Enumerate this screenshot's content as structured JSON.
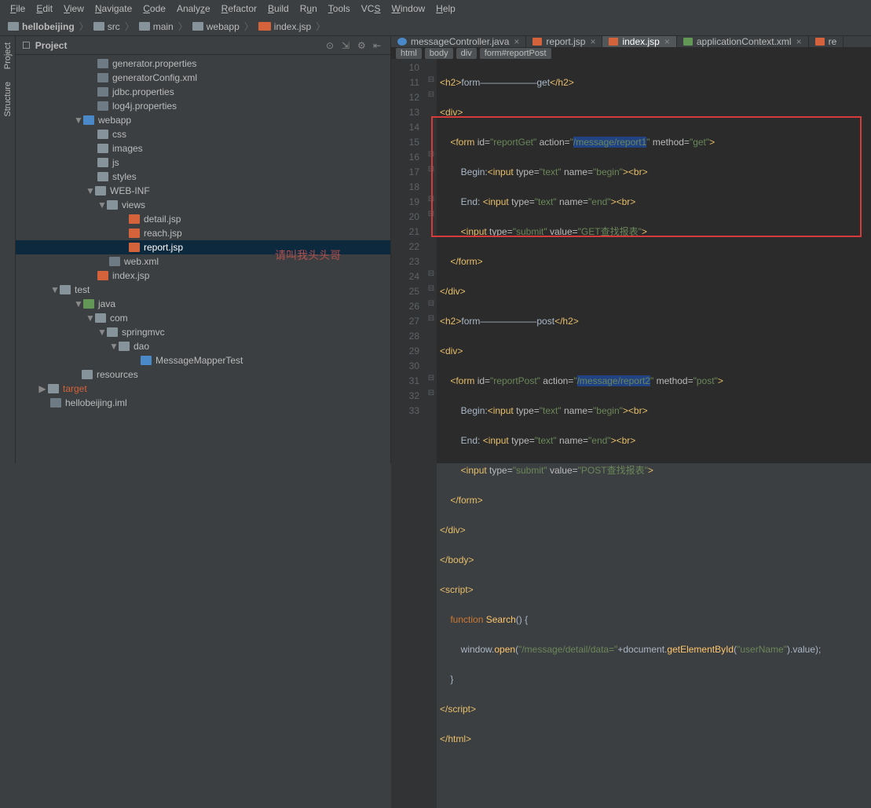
{
  "menu": {
    "items": [
      "File",
      "Edit",
      "View",
      "Navigate",
      "Code",
      "Analyze",
      "Refactor",
      "Build",
      "Run",
      "Tools",
      "VCS",
      "Window",
      "Help"
    ]
  },
  "breadcrumb": {
    "project": "hellobeijing",
    "a": "src",
    "b": "main",
    "c": "webapp",
    "file": "index.jsp"
  },
  "rail": {
    "project": "Project",
    "structure": "Structure"
  },
  "projectPanel": {
    "title": "Project"
  },
  "tree": {
    "n0": "generator.properties",
    "n1": "generatorConfig.xml",
    "n2": "jdbc.properties",
    "n3": "log4j.properties",
    "n4": "webapp",
    "n5": "css",
    "n6": "images",
    "n7": "js",
    "n8": "styles",
    "n9": "WEB-INF",
    "n10": "views",
    "n11": "detail.jsp",
    "n12": "reach.jsp",
    "n13": "report.jsp",
    "n14": "web.xml",
    "n15": "index.jsp",
    "n16": "test",
    "n17": "java",
    "n18": "com",
    "n19": "springmvc",
    "n20": "dao",
    "n21": "MessageMapperTest",
    "n22": "resources",
    "n23": "target",
    "n24": "hellobeijing.iml"
  },
  "watermark": "请叫我头头哥",
  "tabs": {
    "t0": "messageController.java",
    "t1": "report.jsp",
    "t2": "index.jsp",
    "t3": "applicationContext.xml",
    "t4": "re"
  },
  "bc2": {
    "a": "html",
    "b": "body",
    "c": "div",
    "d": "form#reportPost"
  },
  "lines": {
    "l10": "10",
    "l11": "11",
    "l12": "12",
    "l13": "13",
    "l14": "14",
    "l15": "15",
    "l16": "16",
    "l17": "17",
    "l18": "18",
    "l19": "19",
    "l20": "20",
    "l21": "21",
    "l22": "22",
    "l23": "23",
    "l24": "24",
    "l25": "25",
    "l26": "26",
    "l27": "27",
    "l28": "28",
    "l29": "29",
    "l30": "30",
    "l31": "31",
    "l32": "32",
    "l33": "33"
  },
  "code": {
    "c10_a": "<h2>",
    "c10_b": "form——————get",
    "c10_c": "</h2>",
    "c11_a": "<div>",
    "c12_a": "    <form ",
    "c12_b": "id=",
    "c12_c": "\"reportGet\"",
    "c12_d": " action=",
    "c12_e": "\"",
    "c12_f": "/message/report1",
    "c12_g": "\"",
    "c12_h": " method=",
    "c12_i": "\"get\"",
    "c12_j": ">",
    "c13_a": "        Begin:",
    "c13_b": "<input ",
    "c13_c": "type=",
    "c13_d": "\"text\"",
    "c13_e": " name=",
    "c13_f": "\"begin\"",
    "c13_g": "><br>",
    "c14_a": "        End: ",
    "c14_b": "<input ",
    "c14_c": "type=",
    "c14_d": "\"text\"",
    "c14_e": " name=",
    "c14_f": "\"end\"",
    "c14_g": "><br>",
    "c15_a": "        ",
    "c15_b": "<input ",
    "c15_c": "type=",
    "c15_d": "\"submit\"",
    "c15_e": " value=",
    "c15_f": "\"GET查找报表\"",
    "c15_g": ">",
    "c16_a": "    </form>",
    "c17_a": "</div>",
    "c18_a": "<h2>",
    "c18_b": "form——————post",
    "c18_c": "</h2>",
    "c19_a": "<div>",
    "c20_a": "    <form ",
    "c20_b": "id=",
    "c20_c": "\"reportPost\"",
    "c20_d": " action=",
    "c20_e": "\"",
    "c20_f": "/message/report2",
    "c20_g": "\"",
    "c20_h": " method=",
    "c20_i": "\"post\"",
    "c20_j": ">",
    "c21_a": "        Begin:",
    "c21_b": "<input ",
    "c21_c": "type=",
    "c21_d": "\"text\"",
    "c21_e": " name=",
    "c21_f": "\"begin\"",
    "c21_g": "><br>",
    "c22_a": "        End: ",
    "c22_b": "<input ",
    "c22_c": "type=",
    "c22_d": "\"text\"",
    "c22_e": " name=",
    "c22_f": "\"end\"",
    "c22_g": "><br>",
    "c23_a": "        ",
    "c23_b": "<input ",
    "c23_c": "type=",
    "c23_d": "\"submit\"",
    "c23_e": " value=",
    "c23_f": "\"POST查找报表\"",
    "c23_g": ">",
    "c24_a": "    </form>",
    "c25_a": "</div>",
    "c26_a": "</body>",
    "c27_a": "<script>",
    "c28_a": "    ",
    "c28_b": "function ",
    "c28_c": "Search",
    "c28_d": "() {",
    "c29_a": "        window.",
    "c29_b": "open",
    "c29_c": "(",
    "c29_d": "\"/message/detail/data=\"",
    "c29_e": "+document.",
    "c29_f": "getElementById",
    "c29_g": "(",
    "c29_h": "\"userName\"",
    "c29_i": ").value);",
    "c30_a": "    }",
    "c31_a": "</script>",
    "c32_a": "</html>"
  }
}
